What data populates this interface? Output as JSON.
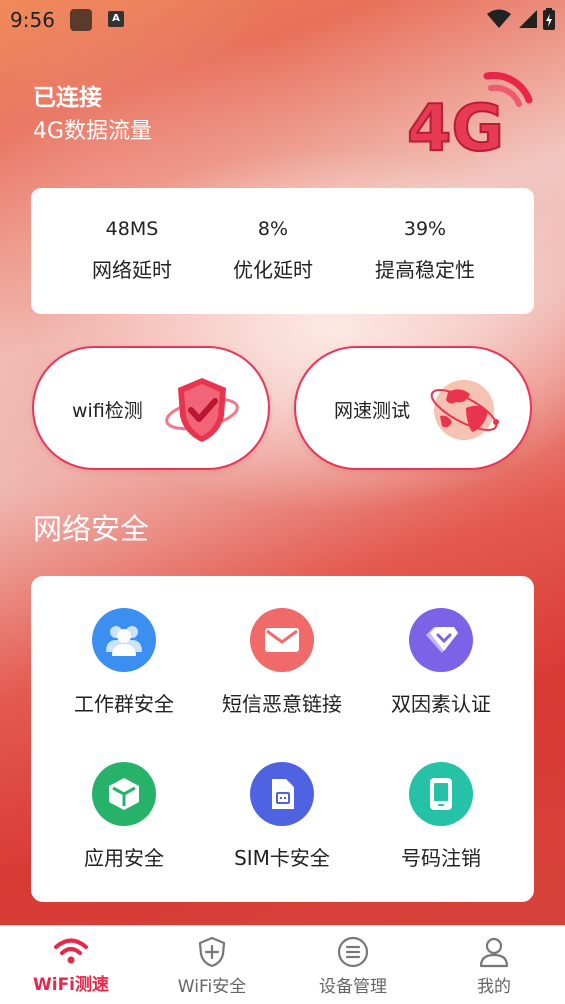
{
  "status_bar": {
    "time": "9:56",
    "app_badge": "A"
  },
  "connection": {
    "title": "已连接",
    "subtitle": "4G数据流量",
    "logo_text": "4G"
  },
  "stats": [
    {
      "value": "48MS",
      "label": "网络延时"
    },
    {
      "value": "8%",
      "label": "优化延时"
    },
    {
      "value": "39%",
      "label": "提高稳定性"
    }
  ],
  "quick_actions": {
    "wifi_check": "wifi检测",
    "speed_test": "网速测试"
  },
  "security": {
    "title": "网络安全",
    "items": [
      {
        "label": "工作群安全",
        "icon": "users-icon",
        "color": "#3a8ff0"
      },
      {
        "label": "短信恶意链接",
        "icon": "mail-icon",
        "color": "#f06a6a"
      },
      {
        "label": "双因素认证",
        "icon": "diamond-icon",
        "color": "#7b62e6"
      },
      {
        "label": "应用安全",
        "icon": "cube-icon",
        "color": "#27b26a"
      },
      {
        "label": "SIM卡安全",
        "icon": "sim-card-icon",
        "color": "#4f63e2"
      },
      {
        "label": "号码注销",
        "icon": "phone-icon",
        "color": "#26c2a8"
      }
    ]
  },
  "tabs": [
    {
      "label": "WiFi测速",
      "icon": "wifi-icon",
      "active": true
    },
    {
      "label": "WiFi安全",
      "icon": "shield-plus-icon",
      "active": false
    },
    {
      "label": "设备管理",
      "icon": "device-list-icon",
      "active": false
    },
    {
      "label": "我的",
      "icon": "user-icon",
      "active": false
    }
  ],
  "colors": {
    "accent": "#e8264a",
    "tab_inactive": "#666666"
  }
}
